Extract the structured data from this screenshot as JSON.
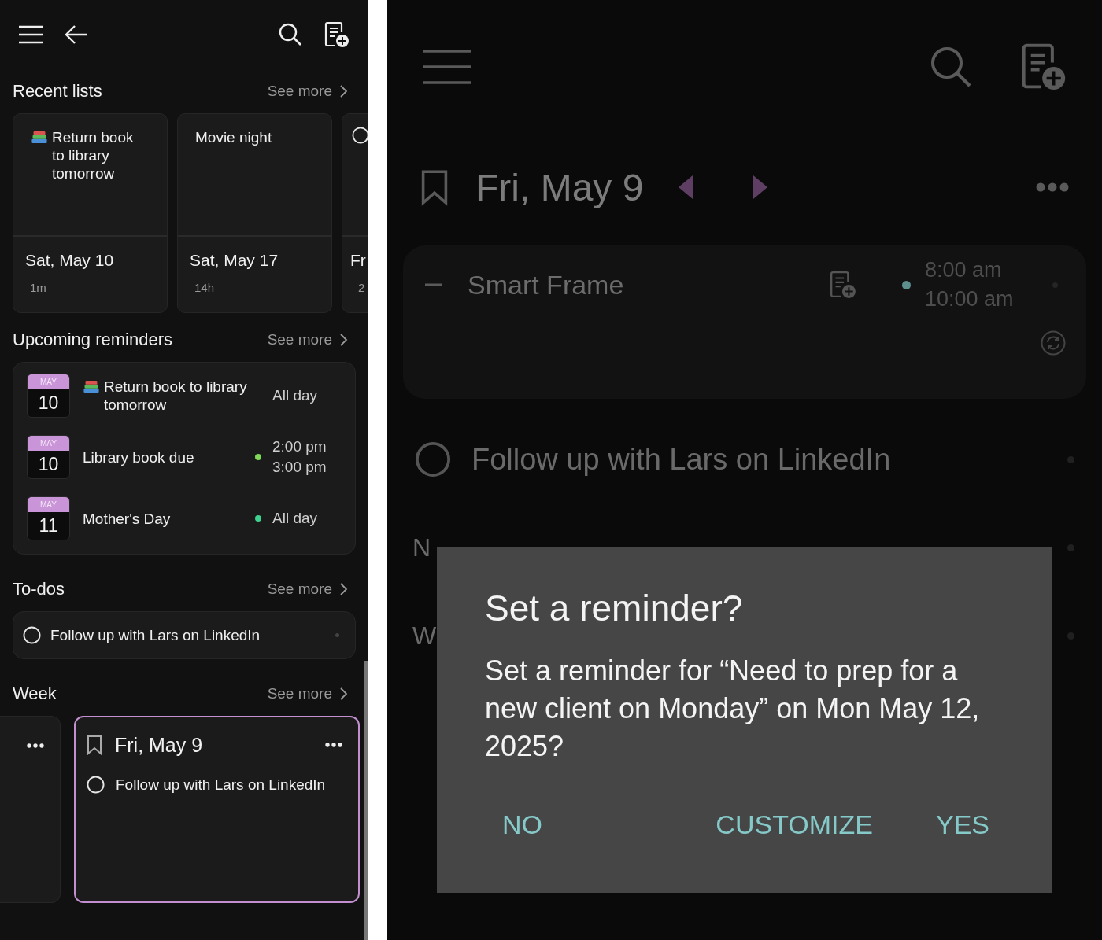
{
  "left_screen": {
    "recent_lists": {
      "title": "Recent lists",
      "see_more": "See more",
      "cards": [
        {
          "kind": "books",
          "title": "Return book to library tomorrow",
          "date": "Sat, May 10",
          "age": "1m"
        },
        {
          "kind": "note",
          "title": "Movie night",
          "date": "Sat, May 17",
          "age": "14h"
        },
        {
          "kind": "todo",
          "date": "Fr",
          "age": "2"
        }
      ]
    },
    "upcoming_reminders": {
      "title": "Upcoming reminders",
      "see_more": "See more",
      "items": [
        {
          "kind": "books",
          "month": "MAY",
          "day": "10",
          "title": "Return book to library tomorrow",
          "times": [
            "All day"
          ]
        },
        {
          "kind": "plain",
          "month": "MAY",
          "day": "10",
          "title": "Library book due",
          "color": "#7ed957",
          "times": [
            "2:00 pm",
            "3:00 pm"
          ]
        },
        {
          "kind": "plain",
          "month": "MAY",
          "day": "11",
          "title": "Mother's Day",
          "color": "#3fd18e",
          "times": [
            "All day"
          ]
        }
      ]
    },
    "todos": {
      "title": "To-dos",
      "see_more": "See more",
      "items": [
        {
          "text": "Follow up with Lars on LinkedIn",
          "checked": false
        }
      ]
    },
    "week": {
      "title": "Week",
      "see_more": "See more",
      "days": [
        {
          "selected": false
        },
        {
          "date": "Fri, May 9",
          "selected": true,
          "tasks": [
            {
              "text": "Follow up with Lars on LinkedIn",
              "checked": false
            }
          ]
        }
      ]
    }
  },
  "right_screen": {
    "day_view": {
      "date": "Fri, May 9",
      "events": [
        {
          "title": "Smart Frame",
          "color": "#5e8f8f",
          "times": [
            "8:00 am",
            "10:00 am"
          ]
        }
      ],
      "tasks": [
        {
          "kind": "todo",
          "text": "Follow up with Lars on LinkedIn",
          "checked": false
        },
        {
          "kind": "note",
          "text": "N"
        },
        {
          "kind": "note",
          "text": "W"
        }
      ]
    },
    "dialog": {
      "title": "Set a reminder?",
      "message": "Set a reminder for “Need to prep for a new client on Monday” on Mon May 12, 2025?",
      "buttons": [
        "NO",
        "CUSTOMIZE",
        "YES"
      ]
    }
  }
}
